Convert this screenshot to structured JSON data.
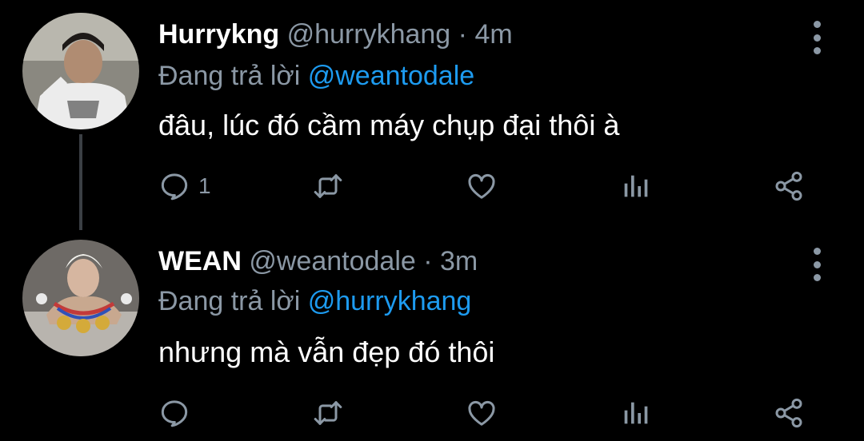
{
  "tweets": [
    {
      "display_name": "Hurrykng",
      "handle": "@hurrykhang",
      "separator": "·",
      "time": "4m",
      "reply_prefix": "Đang trả lời",
      "reply_mention": "@weantodale",
      "text": "đâu, lúc đó cầm máy chụp đại thôi à",
      "reply_count": "1"
    },
    {
      "display_name": "WEAN",
      "handle": "@weantodale",
      "separator": "·",
      "time": "3m",
      "reply_prefix": "Đang trả lời",
      "reply_mention": "@hurrykhang",
      "text": "nhưng mà vẫn đẹp đó thôi",
      "reply_count": ""
    }
  ],
  "icons": [
    "reply-icon",
    "retweet-icon",
    "like-icon",
    "analytics-icon",
    "share-icon",
    "more-options-icon"
  ],
  "colors": {
    "background": "#000000",
    "text": "#ffffff",
    "secondary": "#8b98a5",
    "mention": "#1d9bf0",
    "thread_line": "#3b3f44"
  }
}
